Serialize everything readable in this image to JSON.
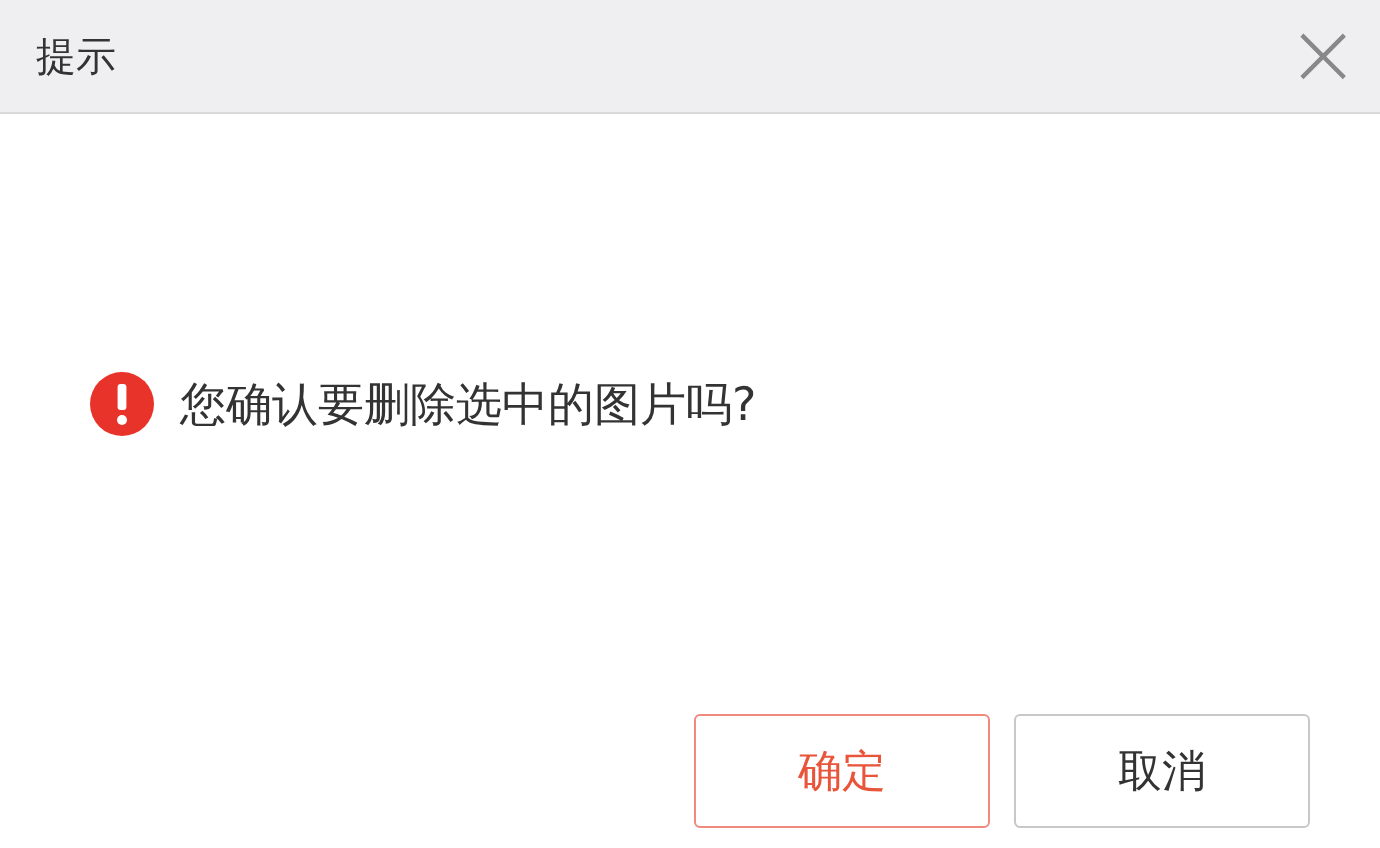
{
  "dialog": {
    "title": "提示",
    "close": "×",
    "message": "您确认要删除选中的图片吗?",
    "buttons": [
      {
        "label": "确定",
        "kind": "primary"
      },
      {
        "label": "取消",
        "kind": "default"
      }
    ]
  }
}
